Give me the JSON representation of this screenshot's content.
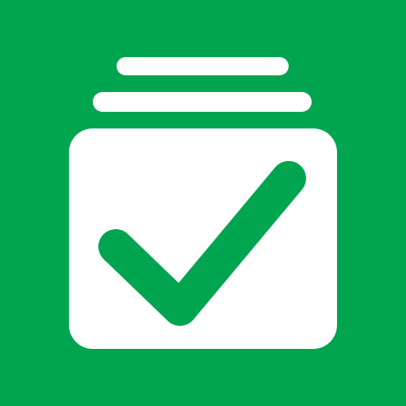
{
  "icon": {
    "name": "checklist-cards-icon",
    "colors": {
      "background": "#02A54F",
      "card": "#FFFFFF",
      "checkmark": "#02A54F"
    }
  }
}
